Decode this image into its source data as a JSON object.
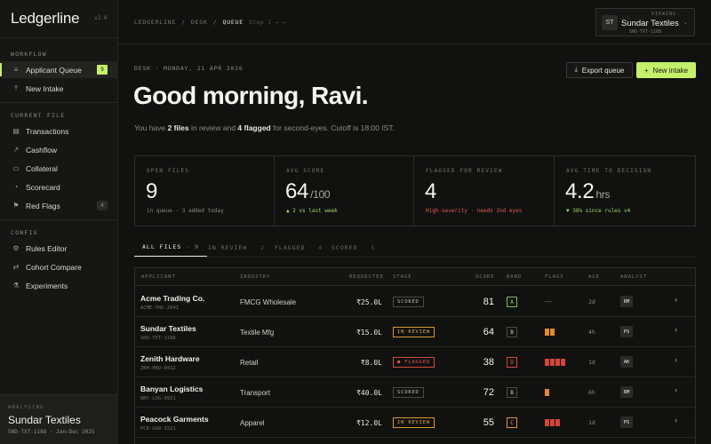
{
  "sidebar": {
    "brand": "Ledgerline",
    "version": "v2.0",
    "sections": [
      {
        "label": "WORKFLOW",
        "items": [
          {
            "label": "Applicant Queue",
            "icon": "list-icon",
            "glyph": "≡",
            "active": true,
            "badge": "9"
          },
          {
            "label": "New Intake",
            "icon": "upload-icon",
            "glyph": "⤒"
          }
        ]
      },
      {
        "label": "CURRENT FILE",
        "items": [
          {
            "label": "Transactions",
            "icon": "ledger-icon",
            "glyph": "▤"
          },
          {
            "label": "Cashflow",
            "icon": "line-chart-icon",
            "glyph": "↗"
          },
          {
            "label": "Collateral",
            "icon": "folder-icon",
            "glyph": "▭"
          },
          {
            "label": "Scorecard",
            "icon": "gauge-icon",
            "glyph": "◔"
          },
          {
            "label": "Red Flags",
            "icon": "flag-icon",
            "glyph": "⚑",
            "badge": "4"
          }
        ]
      },
      {
        "label": "CONFIG",
        "items": [
          {
            "label": "Rules Editor",
            "icon": "settings-icon",
            "glyph": "⚙"
          },
          {
            "label": "Cohort Compare",
            "icon": "compare-icon",
            "glyph": "⇄"
          },
          {
            "label": "Experiments",
            "icon": "flask-icon",
            "glyph": "⚗"
          }
        ]
      }
    ],
    "analysing": {
      "label": "ANALYSING",
      "name": "Sundar Textiles",
      "sub": "SND-TXT-1188 · Jan–Dec 2025"
    }
  },
  "topbar": {
    "crumbs": [
      "LEDGERLINE",
      "/",
      "DESK",
      "/",
      "QUEUE"
    ],
    "step": "Step 1 → →",
    "viewing": {
      "label": "VIEWING",
      "initials": "ST",
      "name": "Sundar Textiles",
      "sub": "SND-TXT-1188"
    }
  },
  "main": {
    "date": "DESK · MONDAY, 21 APR 2026",
    "greeting": "Good morning, Ravi.",
    "summary": {
      "pre": "You have ",
      "files": "2 files",
      "mid": " in review and ",
      "flagged": "4 flagged",
      "post": " for second-eyes. Cutoff is 18:00 IST."
    },
    "export_label": "Export queue",
    "new_label": "New intake",
    "stats": [
      {
        "label": "OPEN FILES",
        "value": "9",
        "unit": "",
        "note": "in queue · 3 added today",
        "tone": ""
      },
      {
        "label": "AVG SCORE",
        "value": "64",
        "unit": "/100",
        "note": "▲ 2 vs last week",
        "tone": "up"
      },
      {
        "label": "FLAGGED FOR REVIEW",
        "value": "4",
        "unit": "",
        "note": "High-severity · needs 2nd eyes",
        "tone": "red"
      },
      {
        "label": "AVG TIME TO DECISION",
        "value": "4.2",
        "unit": "hrs",
        "note": "▼ 38% since rules v4",
        "tone": "up"
      }
    ],
    "tabs": [
      {
        "label": "ALL FILES",
        "count": "9",
        "active": true
      },
      {
        "label": "IN REVIEW",
        "count": "2"
      },
      {
        "label": "FLAGGED",
        "count": "4"
      },
      {
        "label": "SCORED",
        "count": "5"
      }
    ],
    "table": {
      "headers": [
        "APPLICANT",
        "INDUSTRY",
        "REQUESTED",
        "STAGE",
        "SCORE",
        "BAND",
        "FLAGS",
        "AGE",
        "ANALYST"
      ],
      "rows": [
        {
          "name": "Acme Trading Co.",
          "id": "ACME-TRD-2041",
          "industry": "FMCG Wholesale",
          "requested": "₹25.0L",
          "stage": "SCORED",
          "stage_type": "scored",
          "score": "81",
          "band": "A",
          "flag_count": 0,
          "flag_color": "",
          "flag_text": "—",
          "age": "2d",
          "analyst": "RM"
        },
        {
          "name": "Sundar Textiles",
          "id": "SND-TXT-1188",
          "industry": "Textile Mfg",
          "requested": "₹15.0L",
          "stage": "IN REVIEW",
          "stage_type": "review",
          "score": "64",
          "band": "B",
          "flag_count": 2,
          "flag_color": "#e08a2e",
          "flag_text": "",
          "age": "4h",
          "analyst": "PS"
        },
        {
          "name": "Zenith Hardware",
          "id": "ZNH-HRD-0412",
          "industry": "Retail",
          "requested": "₹8.0L",
          "stage": "● FLAGGED",
          "stage_type": "flag",
          "score": "38",
          "band": "D",
          "flag_count": 4,
          "flag_color": "#d0463b",
          "flag_text": "",
          "age": "1d",
          "analyst": "AK"
        },
        {
          "name": "Banyan Logistics",
          "id": "BNY-LOG-0921",
          "industry": "Transport",
          "requested": "₹40.0L",
          "stage": "SCORED",
          "stage_type": "scored",
          "score": "72",
          "band": "B",
          "flag_count": 1,
          "flag_color": "#e08a2e",
          "flag_text": "",
          "age": "6h",
          "analyst": "RM"
        },
        {
          "name": "Peacock Garments",
          "id": "PCK-GAR-3321",
          "industry": "Apparel",
          "requested": "₹12.0L",
          "stage": "IN REVIEW",
          "stage_type": "review",
          "score": "55",
          "band": "C",
          "flag_count": 3,
          "flag_color": "#d0463b",
          "flag_text": "",
          "age": "1d",
          "analyst": "PS"
        }
      ]
    }
  }
}
